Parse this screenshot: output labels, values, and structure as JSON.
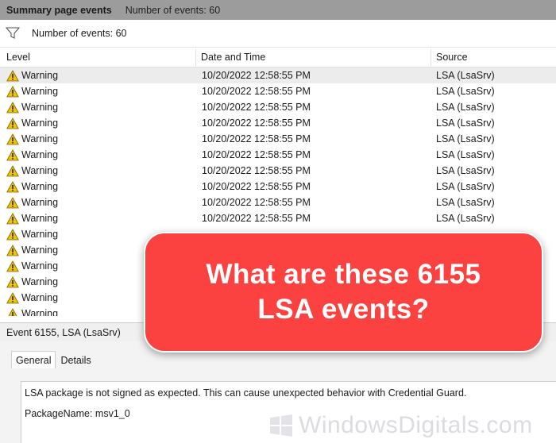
{
  "titlebar": {
    "title": "Summary page events",
    "count": "Number of events: 60"
  },
  "toolbar": {
    "filter_icon": "filter-icon",
    "count": "Number of events: 60"
  },
  "grid": {
    "columns": [
      "Level",
      "Date and Time",
      "Source"
    ],
    "rows": [
      {
        "level": "Warning",
        "date": "10/20/2022 12:58:55 PM",
        "source": "LSA (LsaSrv)"
      },
      {
        "level": "Warning",
        "date": "10/20/2022 12:58:55 PM",
        "source": "LSA (LsaSrv)"
      },
      {
        "level": "Warning",
        "date": "10/20/2022 12:58:55 PM",
        "source": "LSA (LsaSrv)"
      },
      {
        "level": "Warning",
        "date": "10/20/2022 12:58:55 PM",
        "source": "LSA (LsaSrv)"
      },
      {
        "level": "Warning",
        "date": "10/20/2022 12:58:55 PM",
        "source": "LSA (LsaSrv)"
      },
      {
        "level": "Warning",
        "date": "10/20/2022 12:58:55 PM",
        "source": "LSA (LsaSrv)"
      },
      {
        "level": "Warning",
        "date": "10/20/2022 12:58:55 PM",
        "source": "LSA (LsaSrv)"
      },
      {
        "level": "Warning",
        "date": "10/20/2022 12:58:55 PM",
        "source": "LSA (LsaSrv)"
      },
      {
        "level": "Warning",
        "date": "10/20/2022 12:58:55 PM",
        "source": "LSA (LsaSrv)"
      },
      {
        "level": "Warning",
        "date": "10/20/2022 12:58:55 PM",
        "source": "LSA (LsaSrv)"
      },
      {
        "level": "Warning",
        "date": "",
        "source": ""
      },
      {
        "level": "Warning",
        "date": "",
        "source": ""
      },
      {
        "level": "Warning",
        "date": "",
        "source": ""
      },
      {
        "level": "Warning",
        "date": "",
        "source": ""
      },
      {
        "level": "Warning",
        "date": "",
        "source": ""
      },
      {
        "level": "Warning",
        "date": "",
        "source": ""
      }
    ]
  },
  "detail": {
    "title": "Event 6155, LSA (LsaSrv)",
    "tabs": [
      "General",
      "Details"
    ],
    "message": "LSA package is not signed as expected. This can cause unexpected behavior with Credential Guard.",
    "package": "PackageName: msv1_0"
  },
  "banner": {
    "line1": "What are these 6155",
    "line2": "LSA events?"
  },
  "watermark": {
    "text": "WindowsDigitals.com"
  },
  "colors": {
    "banner": "#fb4240",
    "titlebar": "#9c9c9c",
    "selected_row": "#ececec",
    "warning_icon": "#f2c400"
  }
}
